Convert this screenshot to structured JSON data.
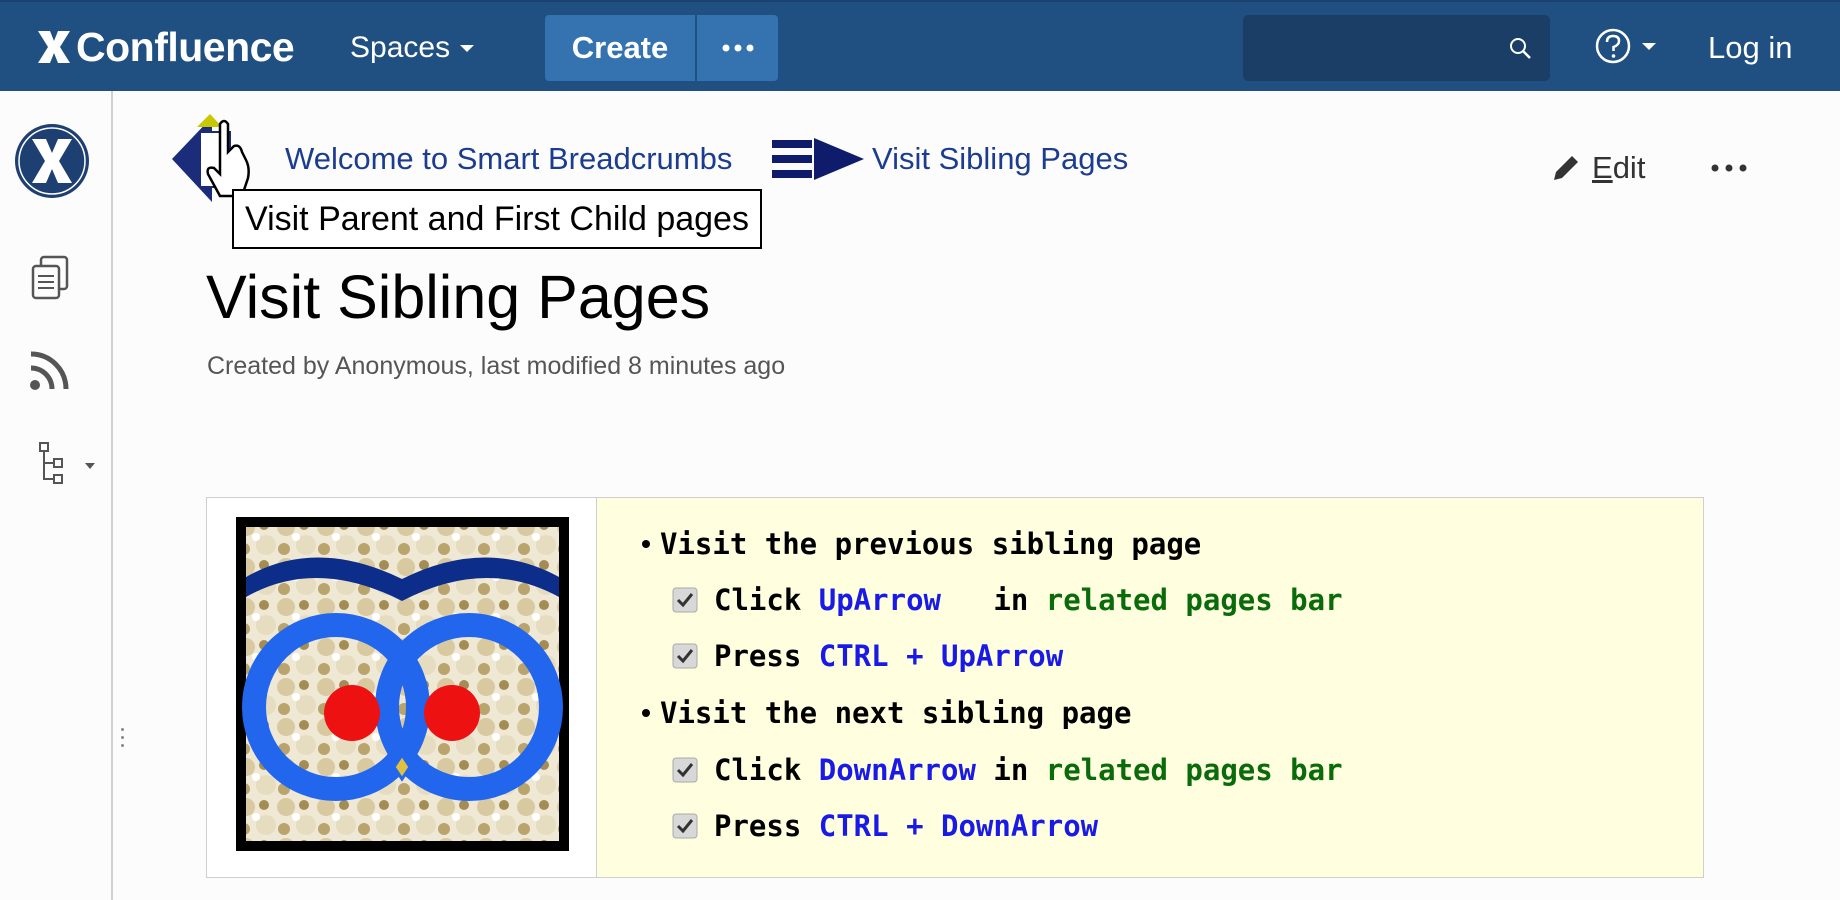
{
  "header": {
    "logo_text": "Confluence",
    "spaces_label": "Spaces",
    "create_label": "Create",
    "login_label": "Log in"
  },
  "breadcrumb": {
    "parent": "Welcome to Smart Breadcrumbs",
    "current": "Visit Sibling Pages",
    "tooltip": "Visit Parent and First Child pages"
  },
  "page": {
    "edit_label_first": "E",
    "edit_label_rest": "dit",
    "title": "Visit Sibling Pages",
    "meta": "Created by Anonymous, last modified 8 minutes ago"
  },
  "content": {
    "prev_heading": "Visit the previous sibling page",
    "prev_items": [
      {
        "verb": "Click ",
        "key": "UpArrow",
        "mid": "   in ",
        "target": "related pages bar"
      },
      {
        "verb": "Press ",
        "key": "CTRL + UpArrow"
      }
    ],
    "next_heading": "Visit the next sibling page",
    "next_items": [
      {
        "verb": "Click ",
        "key": "DownArrow",
        "mid": " in ",
        "target": "related pages bar"
      },
      {
        "verb": "Press ",
        "key": "CTRL + DownArrow"
      }
    ]
  },
  "colors": {
    "header_bg": "#205081",
    "button_bg": "#3572b0",
    "link": "#1c3d8f",
    "panel_bg": "#ffffe0",
    "keyword_blue": "#1a1ae6",
    "keyword_green": "#0a6b0a"
  },
  "icons": [
    "confluence-logo-icon",
    "caret-down-icon",
    "more-dots-icon",
    "search-icon",
    "help-icon",
    "space-logo-icon",
    "pages-icon",
    "rss-icon",
    "page-tree-icon",
    "breadcrumb-home-icon",
    "breadcrumb-separator-icon",
    "pencil-icon",
    "checkbox-icon",
    "owl-image"
  ]
}
